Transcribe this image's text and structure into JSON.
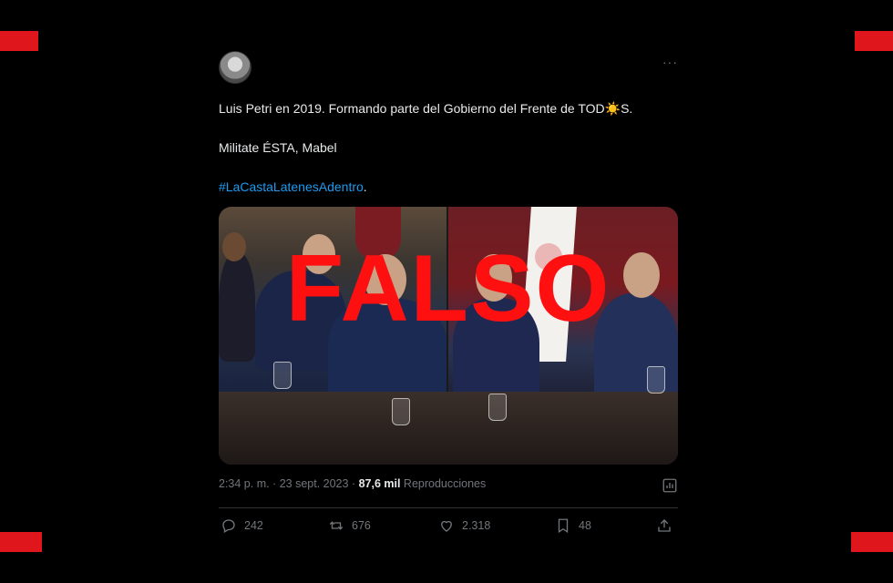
{
  "tweet": {
    "text_line1": "Luis Petri en 2019. Formando parte del Gobierno del Frente de TOD",
    "text_line1_emoji": "☀️",
    "text_line1_end": "S.",
    "text_line2": "Militate ÉSTA, Mabel",
    "hashtag": "#LaCastaLatenesAdentro",
    "hashtag_suffix": ".",
    "more_label": "···",
    "overlay_text": "FALSO",
    "meta": {
      "time": "2:34 p. m. · 23 sept. 2023 · ",
      "views_count": "87,6 mil",
      "views_label": " Reproducciones"
    },
    "actions": {
      "replies": "242",
      "retweets": "676",
      "likes": "2.318",
      "bookmarks": "48"
    }
  },
  "colors": {
    "background": "#000000",
    "accent_blue": "#1d9bf0",
    "stamp_red": "#ff1010",
    "corner_red": "#e0161d",
    "muted": "#71767b"
  },
  "icons": [
    "reply-icon",
    "retweet-icon",
    "like-icon",
    "bookmark-icon",
    "share-icon",
    "analytics-icon"
  ]
}
